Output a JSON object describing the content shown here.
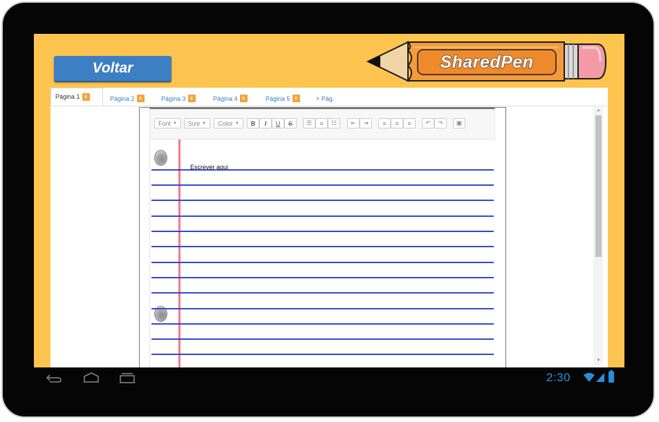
{
  "header": {
    "back_label": "Voltar",
    "logo_text": "SharedPen"
  },
  "tabs": [
    {
      "label": "Página 1",
      "close": "x",
      "active": true
    },
    {
      "label": "Página 2",
      "close": "x"
    },
    {
      "label": "Página 3",
      "close": "x"
    },
    {
      "label": "Página 4",
      "close": "x"
    },
    {
      "label": "Página 5",
      "close": "x"
    },
    {
      "label": "+ Pág."
    }
  ],
  "toolbar": {
    "font_label": "Font",
    "size_label": "Size",
    "color_label": "Color",
    "bold": "B",
    "italic": "I",
    "underline": "U",
    "strike": "S",
    "icons": [
      "bullet-list-icon",
      "numbered-list-icon",
      "checklist-icon",
      "outdent-icon",
      "indent-icon",
      "align-left-icon",
      "align-center-icon",
      "align-right-icon",
      "undo-icon",
      "redo-icon",
      "image-icon"
    ]
  },
  "editor": {
    "text": "Escrever aqui"
  },
  "status_bar": {
    "time": "2:30"
  },
  "colors": {
    "background": "#fdc54f",
    "button": "#3d7fc3",
    "rule": "#3646cf",
    "margin": "#f07c84",
    "tab_close": "#f3a43a",
    "pencil": "#f59a3c"
  }
}
